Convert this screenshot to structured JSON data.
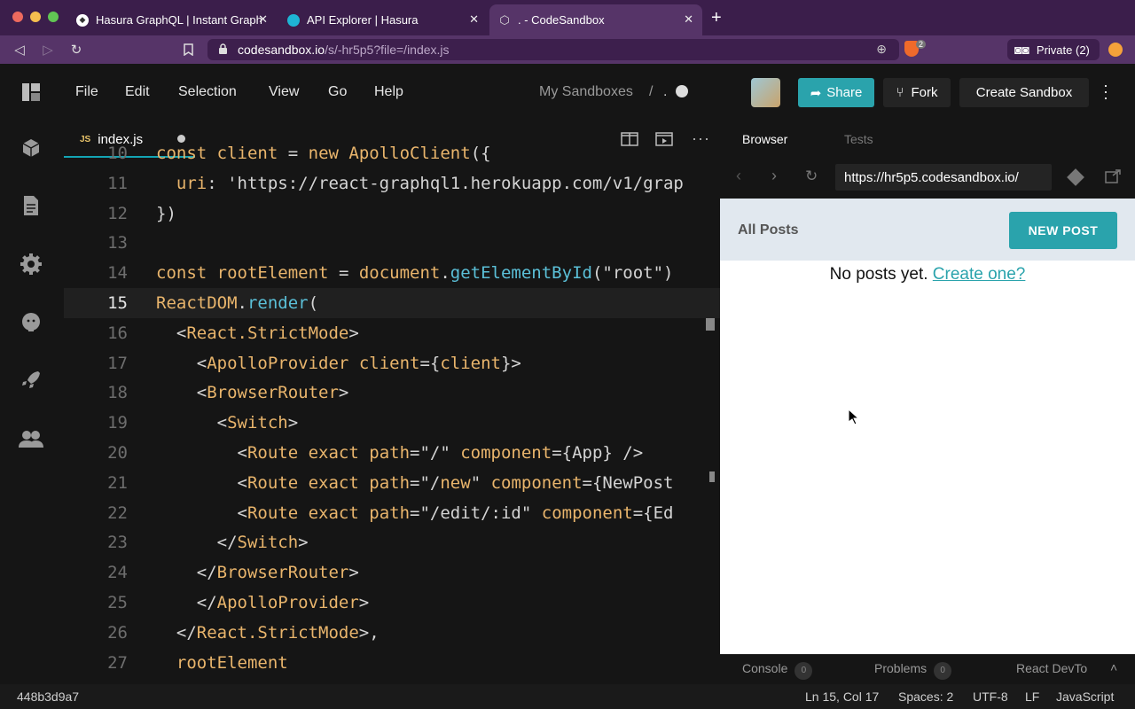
{
  "browser": {
    "tabs": [
      {
        "title": "Hasura GraphQL | Instant Graph"
      },
      {
        "title": "API Explorer | Hasura"
      },
      {
        "title": ". - CodeSandbox"
      }
    ],
    "url_host": "codesandbox.io",
    "url_path": "/s/-hr5p5?file=/index.js",
    "private_label": "Private (2)",
    "shield_count": "2"
  },
  "menubar": {
    "items": [
      "File",
      "Edit",
      "Selection",
      "View",
      "Go",
      "Help"
    ],
    "breadcrumb_root": "My Sandboxes",
    "breadcrumb_sep": "/",
    "breadcrumb_name": ".",
    "share_label": "Share",
    "fork_label": "Fork",
    "create_label": "Create Sandbox"
  },
  "editor": {
    "tab_badge": "JS",
    "tab_label": "index.js",
    "current_line": 15,
    "lines": [
      {
        "num": "10",
        "code": "const client = new ApolloClient({"
      },
      {
        "num": "11",
        "code": "  uri: 'https://react-graphql1.herokuapp.com/v1/grap"
      },
      {
        "num": "12",
        "code": "})"
      },
      {
        "num": "13",
        "code": ""
      },
      {
        "num": "14",
        "code": "const rootElement = document.getElementById(\"root\")"
      },
      {
        "num": "15",
        "code": "ReactDOM.render("
      },
      {
        "num": "16",
        "code": "  <React.StrictMode>"
      },
      {
        "num": "17",
        "code": "    <ApolloProvider client={client}>"
      },
      {
        "num": "18",
        "code": "    <BrowserRouter>"
      },
      {
        "num": "19",
        "code": "      <Switch>"
      },
      {
        "num": "20",
        "code": "        <Route exact path=\"/\" component={App} />"
      },
      {
        "num": "21",
        "code": "        <Route exact path=\"/new\" component={NewPost"
      },
      {
        "num": "22",
        "code": "        <Route exact path=\"/edit/:id\" component={Ed"
      },
      {
        "num": "23",
        "code": "      </Switch>"
      },
      {
        "num": "24",
        "code": "    </BrowserRouter>"
      },
      {
        "num": "25",
        "code": "    </ApolloProvider>"
      },
      {
        "num": "26",
        "code": "  </React.StrictMode>,"
      },
      {
        "num": "27",
        "code": "  rootElement"
      }
    ]
  },
  "preview": {
    "tab_browser": "Browser",
    "tab_tests": "Tests",
    "url": "https://hr5p5.codesandbox.io/",
    "page_title": "All Posts",
    "new_post_label": "NEW POST",
    "empty_text": "No posts yet.",
    "create_link": "Create one?"
  },
  "bottom_panel": {
    "console_label": "Console",
    "console_count": "0",
    "problems_label": "Problems",
    "problems_count": "0",
    "devtools_label": "React DevTo"
  },
  "status": {
    "commit": "448b3d9a7",
    "position": "Ln 15, Col 17",
    "spaces": "Spaces: 2",
    "encoding": "UTF-8",
    "eol": "LF",
    "language": "JavaScript"
  },
  "colors": {
    "accent": "#13a4b4",
    "share_bg": "#2aa3ac",
    "browser_chrome": "#563468"
  }
}
